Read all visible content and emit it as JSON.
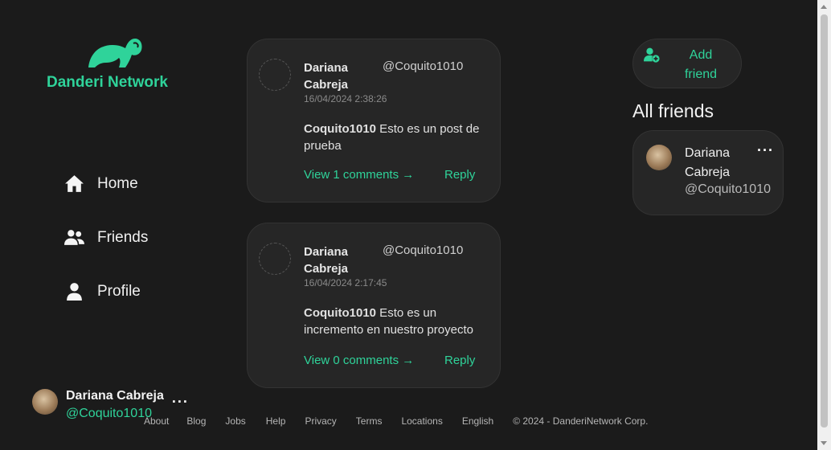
{
  "brand": {
    "name": "Danderi Network"
  },
  "nav": [
    {
      "label": "Home",
      "icon": "home-icon"
    },
    {
      "label": "Friends",
      "icon": "friends-icon"
    },
    {
      "label": "Profile",
      "icon": "profile-icon"
    }
  ],
  "current_user": {
    "name": "Dariana Cabreja",
    "handle": "@Coquito1010"
  },
  "posts": [
    {
      "author": "Dariana Cabreja",
      "handle": "@Coquito1010",
      "date": "16/04/2024 2:38:26",
      "body_user": "Coquito1010",
      "body_text": " Esto es un post de prueba",
      "view_label": "View 1 comments →",
      "reply_label": "Reply"
    },
    {
      "author": "Dariana Cabreja",
      "handle": "@Coquito1010",
      "date": "16/04/2024 2:17:45",
      "body_user": "Coquito1010",
      "body_text": " Esto es un incremento en nuestro proyecto",
      "view_label": "View 0 comments →",
      "reply_label": "Reply"
    }
  ],
  "add_friend_label": "Add friend",
  "all_friends_title": "All friends",
  "friends": [
    {
      "name": "Dariana Cabreja",
      "handle": "@Coquito1010"
    }
  ],
  "footer": {
    "links": [
      "About",
      "Blog",
      "Jobs",
      "Help",
      "Privacy",
      "Terms",
      "Locations",
      "English"
    ],
    "copyright": "© 2024 - DanderiNetwork Corp."
  },
  "colors": {
    "accent": "#2fd39a",
    "background": "#1b1b1b",
    "card": "#262626"
  }
}
